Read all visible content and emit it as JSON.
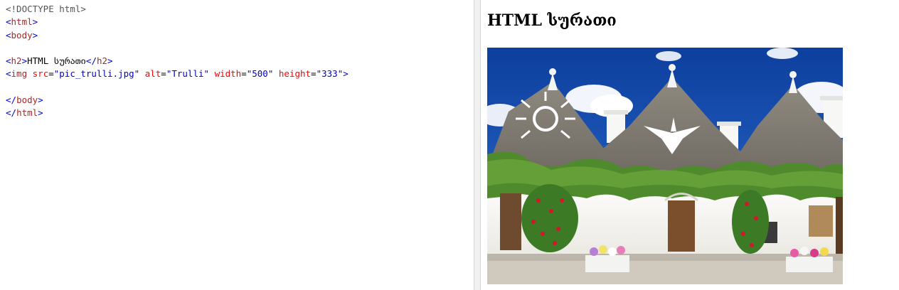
{
  "editor": {
    "lines": [
      {
        "kind": "doctype",
        "text": "<!DOCTYPE html>"
      },
      {
        "kind": "open",
        "tag": "html"
      },
      {
        "kind": "open",
        "tag": "body"
      },
      {
        "kind": "blank"
      },
      {
        "kind": "h2",
        "tag": "h2",
        "text": "HTML სურათი"
      },
      {
        "kind": "img",
        "tag": "img",
        "attrs": [
          {
            "name": "src",
            "value": "\"pic_trulli.jpg\""
          },
          {
            "name": "alt",
            "value": "\"Trulli\""
          },
          {
            "name": "width",
            "value": "\"500\""
          },
          {
            "name": "height",
            "value": "\"333\""
          }
        ]
      },
      {
        "kind": "blank"
      },
      {
        "kind": "close",
        "tag": "body"
      },
      {
        "kind": "close",
        "tag": "html"
      }
    ]
  },
  "preview": {
    "heading": "HTML სურათი",
    "image_alt": "Trulli"
  },
  "colors": {
    "tag": "#a52a2a",
    "bracket": "#0000cd",
    "attribute": "#ff0000",
    "value": "#0000cd"
  }
}
